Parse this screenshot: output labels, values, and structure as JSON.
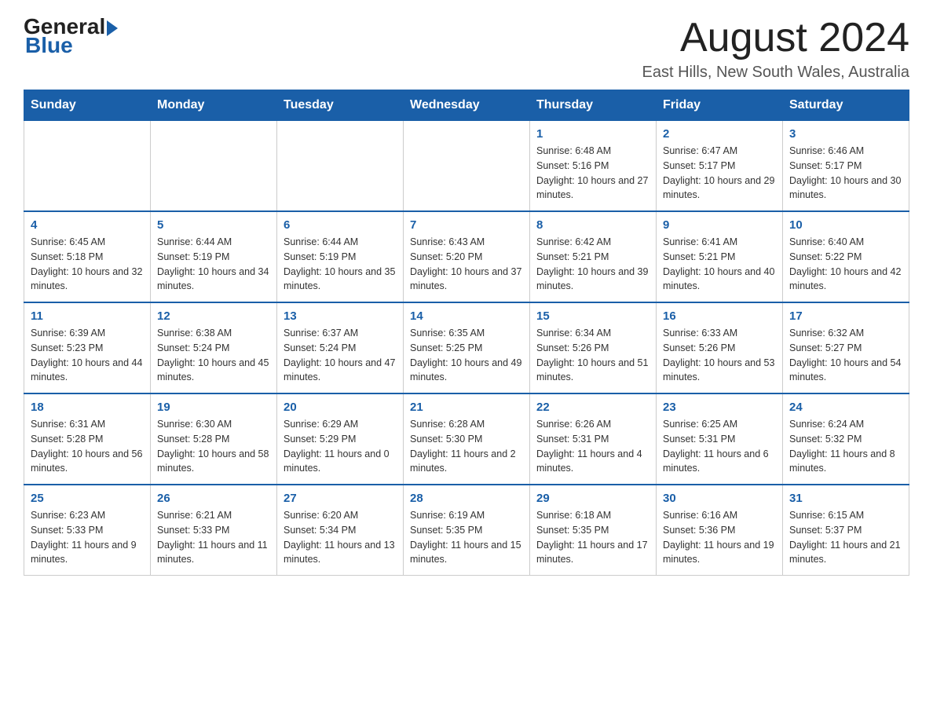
{
  "header": {
    "logo_general": "General",
    "logo_blue": "Blue",
    "month_title": "August 2024",
    "location": "East Hills, New South Wales, Australia"
  },
  "calendar": {
    "days_of_week": [
      "Sunday",
      "Monday",
      "Tuesday",
      "Wednesday",
      "Thursday",
      "Friday",
      "Saturday"
    ],
    "weeks": [
      [
        {
          "day": "",
          "info": ""
        },
        {
          "day": "",
          "info": ""
        },
        {
          "day": "",
          "info": ""
        },
        {
          "day": "",
          "info": ""
        },
        {
          "day": "1",
          "info": "Sunrise: 6:48 AM\nSunset: 5:16 PM\nDaylight: 10 hours and 27 minutes."
        },
        {
          "day": "2",
          "info": "Sunrise: 6:47 AM\nSunset: 5:17 PM\nDaylight: 10 hours and 29 minutes."
        },
        {
          "day": "3",
          "info": "Sunrise: 6:46 AM\nSunset: 5:17 PM\nDaylight: 10 hours and 30 minutes."
        }
      ],
      [
        {
          "day": "4",
          "info": "Sunrise: 6:45 AM\nSunset: 5:18 PM\nDaylight: 10 hours and 32 minutes."
        },
        {
          "day": "5",
          "info": "Sunrise: 6:44 AM\nSunset: 5:19 PM\nDaylight: 10 hours and 34 minutes."
        },
        {
          "day": "6",
          "info": "Sunrise: 6:44 AM\nSunset: 5:19 PM\nDaylight: 10 hours and 35 minutes."
        },
        {
          "day": "7",
          "info": "Sunrise: 6:43 AM\nSunset: 5:20 PM\nDaylight: 10 hours and 37 minutes."
        },
        {
          "day": "8",
          "info": "Sunrise: 6:42 AM\nSunset: 5:21 PM\nDaylight: 10 hours and 39 minutes."
        },
        {
          "day": "9",
          "info": "Sunrise: 6:41 AM\nSunset: 5:21 PM\nDaylight: 10 hours and 40 minutes."
        },
        {
          "day": "10",
          "info": "Sunrise: 6:40 AM\nSunset: 5:22 PM\nDaylight: 10 hours and 42 minutes."
        }
      ],
      [
        {
          "day": "11",
          "info": "Sunrise: 6:39 AM\nSunset: 5:23 PM\nDaylight: 10 hours and 44 minutes."
        },
        {
          "day": "12",
          "info": "Sunrise: 6:38 AM\nSunset: 5:24 PM\nDaylight: 10 hours and 45 minutes."
        },
        {
          "day": "13",
          "info": "Sunrise: 6:37 AM\nSunset: 5:24 PM\nDaylight: 10 hours and 47 minutes."
        },
        {
          "day": "14",
          "info": "Sunrise: 6:35 AM\nSunset: 5:25 PM\nDaylight: 10 hours and 49 minutes."
        },
        {
          "day": "15",
          "info": "Sunrise: 6:34 AM\nSunset: 5:26 PM\nDaylight: 10 hours and 51 minutes."
        },
        {
          "day": "16",
          "info": "Sunrise: 6:33 AM\nSunset: 5:26 PM\nDaylight: 10 hours and 53 minutes."
        },
        {
          "day": "17",
          "info": "Sunrise: 6:32 AM\nSunset: 5:27 PM\nDaylight: 10 hours and 54 minutes."
        }
      ],
      [
        {
          "day": "18",
          "info": "Sunrise: 6:31 AM\nSunset: 5:28 PM\nDaylight: 10 hours and 56 minutes."
        },
        {
          "day": "19",
          "info": "Sunrise: 6:30 AM\nSunset: 5:28 PM\nDaylight: 10 hours and 58 minutes."
        },
        {
          "day": "20",
          "info": "Sunrise: 6:29 AM\nSunset: 5:29 PM\nDaylight: 11 hours and 0 minutes."
        },
        {
          "day": "21",
          "info": "Sunrise: 6:28 AM\nSunset: 5:30 PM\nDaylight: 11 hours and 2 minutes."
        },
        {
          "day": "22",
          "info": "Sunrise: 6:26 AM\nSunset: 5:31 PM\nDaylight: 11 hours and 4 minutes."
        },
        {
          "day": "23",
          "info": "Sunrise: 6:25 AM\nSunset: 5:31 PM\nDaylight: 11 hours and 6 minutes."
        },
        {
          "day": "24",
          "info": "Sunrise: 6:24 AM\nSunset: 5:32 PM\nDaylight: 11 hours and 8 minutes."
        }
      ],
      [
        {
          "day": "25",
          "info": "Sunrise: 6:23 AM\nSunset: 5:33 PM\nDaylight: 11 hours and 9 minutes."
        },
        {
          "day": "26",
          "info": "Sunrise: 6:21 AM\nSunset: 5:33 PM\nDaylight: 11 hours and 11 minutes."
        },
        {
          "day": "27",
          "info": "Sunrise: 6:20 AM\nSunset: 5:34 PM\nDaylight: 11 hours and 13 minutes."
        },
        {
          "day": "28",
          "info": "Sunrise: 6:19 AM\nSunset: 5:35 PM\nDaylight: 11 hours and 15 minutes."
        },
        {
          "day": "29",
          "info": "Sunrise: 6:18 AM\nSunset: 5:35 PM\nDaylight: 11 hours and 17 minutes."
        },
        {
          "day": "30",
          "info": "Sunrise: 6:16 AM\nSunset: 5:36 PM\nDaylight: 11 hours and 19 minutes."
        },
        {
          "day": "31",
          "info": "Sunrise: 6:15 AM\nSunset: 5:37 PM\nDaylight: 11 hours and 21 minutes."
        }
      ]
    ]
  }
}
